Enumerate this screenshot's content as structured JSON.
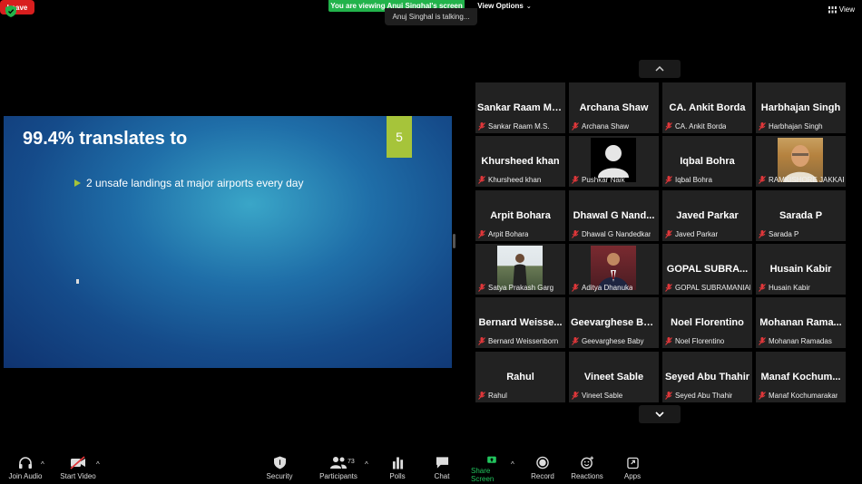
{
  "top": {
    "viewing_banner": "You are viewing Anuj Singhal's screen",
    "view_options": "View Options",
    "talking": "Anuj Singhal is talking...",
    "view": "View"
  },
  "slide": {
    "title": "99.4% translates to",
    "number": "5",
    "bullet": "2 unsafe landings at major airports every day"
  },
  "gallery": [
    {
      "big": "Sankar Raam M.S.",
      "label": "Sankar Raam M.S."
    },
    {
      "big": "Archana Shaw",
      "label": "Archana Shaw"
    },
    {
      "big": "CA. Ankit Borda",
      "label": "CA. Ankit Borda"
    },
    {
      "big": "Harbhajan Singh",
      "label": "Harbhajan Singh"
    },
    {
      "big": "Khursheed khan",
      "label": "Khursheed khan"
    },
    {
      "big": "",
      "label": "Pushkar Naik",
      "photo": "avatar-placeholder"
    },
    {
      "big": "Iqbal Bohra",
      "label": "Iqbal Bohra"
    },
    {
      "big": "",
      "label": "RAMKISHORE JAKKAR...",
      "photo": "portrait"
    },
    {
      "big": "Arpit Bohara",
      "label": "Arpit Bohara"
    },
    {
      "big": "Dhawal G Nand...",
      "label": "Dhawal G Nandedkar"
    },
    {
      "big": "Javed Parkar",
      "label": "Javed Parkar"
    },
    {
      "big": "Sarada P",
      "label": "Sarada P"
    },
    {
      "big": "",
      "label": "Satya Prakash Garg",
      "photo": "outdoor"
    },
    {
      "big": "",
      "label": "Aditya Dhanuka",
      "photo": "suit"
    },
    {
      "big": "GOPAL SUBRA...",
      "label": "GOPAL SUBRAMANIAN"
    },
    {
      "big": "Husain Kabir",
      "label": "Husain Kabir"
    },
    {
      "big": "Bernard Weisse...",
      "label": "Bernard Weissenborn"
    },
    {
      "big": "Geevarghese Ba...",
      "label": "Geevarghese Baby"
    },
    {
      "big": "Noel Florentino",
      "label": "Noel Florentino"
    },
    {
      "big": "Mohanan Rama...",
      "label": "Mohanan Ramadas"
    },
    {
      "big": "Rahul",
      "label": "Rahul"
    },
    {
      "big": "Vineet Sable",
      "label": "Vineet Sable"
    },
    {
      "big": "Seyed Abu Thahir",
      "label": "Seyed Abu Thahir"
    },
    {
      "big": "Manaf Kochum...",
      "label": "Manaf Kochumarakar"
    }
  ],
  "toolbar": {
    "join_audio": "Join Audio",
    "start_video": "Start Video",
    "security": "Security",
    "participants": "Participants",
    "participants_count": "73",
    "polls": "Polls",
    "chat": "Chat",
    "share_screen": "Share Screen",
    "record": "Record",
    "reactions": "Reactions",
    "apps": "Apps",
    "leave": "Leave"
  },
  "colors": {
    "banner_green": "#22b34b",
    "share_green": "#22c55e",
    "leave_red": "#d81e1e",
    "slide_accent": "#a6c43a",
    "muted_red": "#e0373a"
  }
}
